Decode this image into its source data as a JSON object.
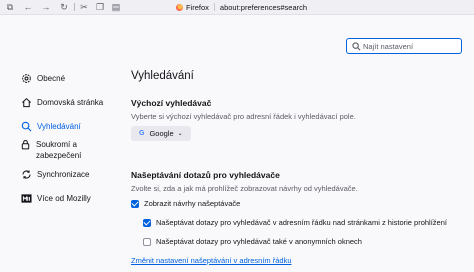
{
  "browser": {
    "brand": "Firefox",
    "url": "about:preferences#search"
  },
  "search": {
    "placeholder": "Najít nastavení"
  },
  "sidebar": {
    "items": [
      {
        "label": "Obecné",
        "icon": "gear-icon"
      },
      {
        "label": "Domovská stránka",
        "icon": "home-icon"
      },
      {
        "label": "Vyhledávání",
        "icon": "search-icon",
        "active": true
      },
      {
        "label": "Soukromí a zabezpečení",
        "icon": "lock-icon"
      },
      {
        "label": "Synchronizace",
        "icon": "sync-icon"
      },
      {
        "label": "Více od Mozilly",
        "icon": "mozilla-icon"
      }
    ]
  },
  "main": {
    "title": "Vyhledávání",
    "default_engine": {
      "heading": "Výchozí vyhledávač",
      "description": "Vyberte si výchozí vyhledávač pro adresní řádek i vyhledávací pole.",
      "selected": "Google"
    },
    "suggestions": {
      "heading": "Našeptávání dotazů pro vyhledávače",
      "description": "Zvolte si, zda a jak má prohlížeč zobrazovat návrhy od vyhledávače.",
      "checkboxes": [
        {
          "label": "Zobrazit návrhy našeptávače",
          "checked": true
        },
        {
          "label": "Našeptávat dotazy pro vyhledávač v adresním řádku nad stránkami z historie prohlížení",
          "checked": true
        },
        {
          "label": "Našeptávat dotazy pro vyhledávač také v anonymních oknech",
          "checked": false
        }
      ],
      "link": "Změnit nastavení našeptávání v adresním řádku"
    }
  },
  "colors": {
    "accent": "#0061e0",
    "background": "#f9f9fb",
    "text": "#15141a",
    "muted": "#5b5b66"
  }
}
